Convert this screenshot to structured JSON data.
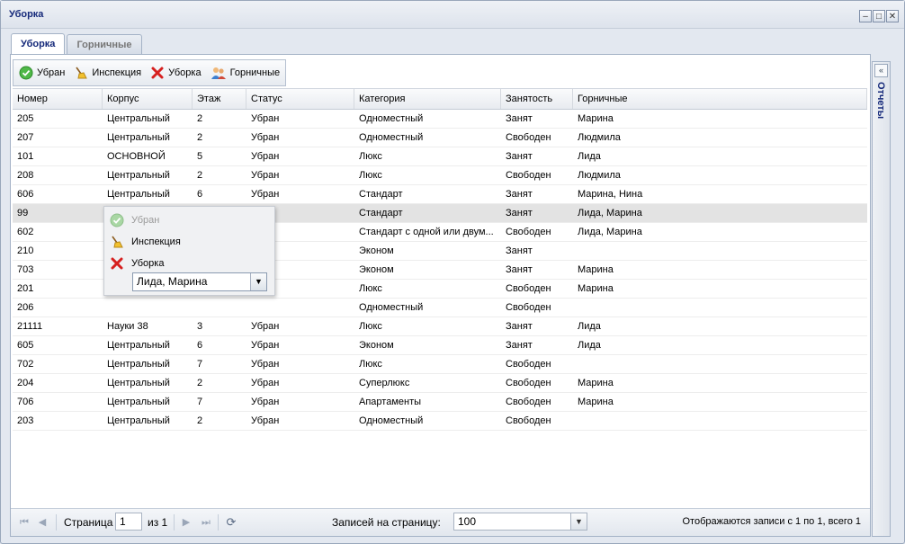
{
  "window": {
    "title": "Уборка",
    "minimize": "–",
    "maximize": "□",
    "close": "✕"
  },
  "tabs": [
    {
      "label": "Уборка",
      "active": true
    },
    {
      "label": "Горничные",
      "active": false
    }
  ],
  "toolbar": {
    "cleaned": "Убран",
    "inspection": "Инспекция",
    "cleaning": "Уборка",
    "maids": "Горничные"
  },
  "grid": {
    "columns": [
      "Номер",
      "Корпус",
      "Этаж",
      "Статус",
      "Категория",
      "Занятость",
      "Горничные"
    ],
    "rows": [
      [
        "205",
        "Центральный",
        "2",
        "Убран",
        "Одноместный",
        "Занят",
        "Марина"
      ],
      [
        "207",
        "Центральный",
        "2",
        "Убран",
        "Одноместный",
        "Свободен",
        "Людмила"
      ],
      [
        "101",
        "ОСНОВНОЙ",
        "5",
        "Убран",
        "Люкс",
        "Занят",
        "Лида"
      ],
      [
        "208",
        "Центральный",
        "2",
        "Убран",
        "Люкс",
        "Свободен",
        "Людмила"
      ],
      [
        "606",
        "Центральный",
        "6",
        "Убран",
        "Стандарт",
        "Занят",
        "Марина, Нина"
      ],
      [
        "99",
        "",
        "",
        "",
        "Стандарт",
        "Занят",
        "Лида, Марина"
      ],
      [
        "602",
        "",
        "",
        "",
        "Стандарт с одной или двум...",
        "Свободен",
        "Лида, Марина"
      ],
      [
        "210",
        "",
        "",
        "",
        "Эконом",
        "Занят",
        ""
      ],
      [
        "703",
        "",
        "",
        "",
        "Эконом",
        "Занят",
        "Марина"
      ],
      [
        "201",
        "",
        "",
        "",
        "Люкс",
        "Свободен",
        "Марина"
      ],
      [
        "206",
        "",
        "",
        "",
        "Одноместный",
        "Свободен",
        ""
      ],
      [
        "21111",
        "Науки 38",
        "3",
        "Убран",
        "Люкс",
        "Занят",
        "Лида"
      ],
      [
        "605",
        "Центральный",
        "6",
        "Убран",
        "Эконом",
        "Занят",
        "Лида"
      ],
      [
        "702",
        "Центральный",
        "7",
        "Убран",
        "Люкс",
        "Свободен",
        ""
      ],
      [
        "204",
        "Центральный",
        "2",
        "Убран",
        "Суперлюкс",
        "Свободен",
        "Марина"
      ],
      [
        "706",
        "Центральный",
        "7",
        "Убран",
        "Апартаменты",
        "Свободен",
        "Марина"
      ],
      [
        "203",
        "Центральный",
        "2",
        "Убран",
        "Одноместный",
        "Свободен",
        ""
      ]
    ],
    "selected_row": 5
  },
  "popup": {
    "cleaned": "Убран",
    "inspection": "Инспекция",
    "cleaning": "Уборка",
    "maids_value": "Лида, Марина"
  },
  "paging": {
    "page_label": "Страница",
    "page_value": "1",
    "of_label": "из 1",
    "per_page_label": "Записей на страницу:",
    "per_page_value": "100",
    "summary": "Отображаются записи с 1 по 1, всего 1"
  },
  "side_panel": {
    "title": "Отчеты",
    "toggle": "«"
  },
  "colors": {
    "title": "#15297a",
    "selected_row": "#e3e3e3"
  }
}
